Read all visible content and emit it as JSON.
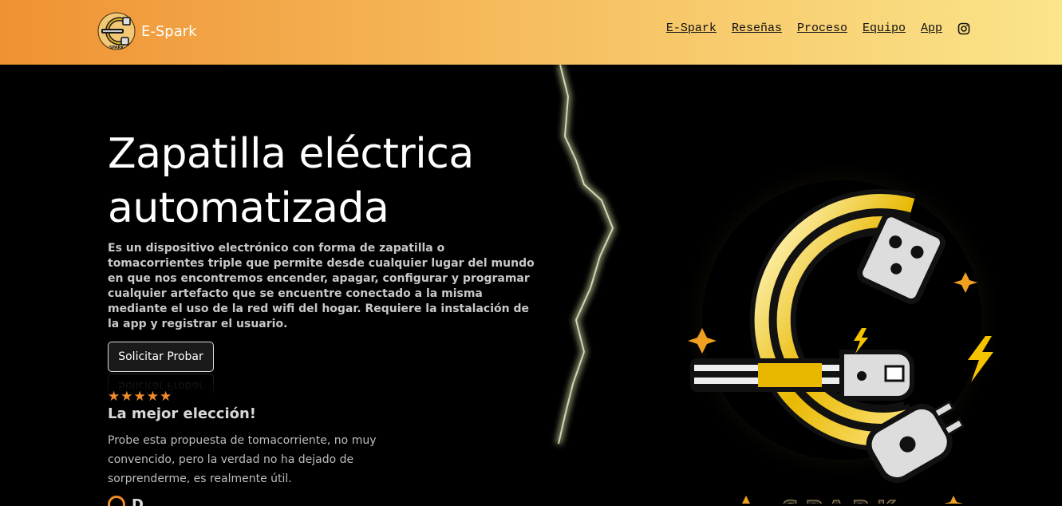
{
  "navbar": {
    "brand": "E-Spark",
    "links": [
      "E-Spark",
      "Reseñas",
      "Proceso",
      "Equipo",
      "App"
    ],
    "social_icon": "instagram-icon",
    "gradient": [
      "#ef9233",
      "#fbe58a"
    ]
  },
  "hero": {
    "title": "Zapatilla eléctrica automatizada",
    "description": "Es un dispositivo electrónico con forma de zapatilla o tomacorrientes triple que permite desde cualquier lugar del mundo en que nos encontremos encender, apagar, configurar y programar cualquier artefacto que se encuentre conectado a la misma mediante el uso de la red wifi del hogar. Requiere la instalación de la app y registrar el usuario.",
    "cta_label": "Solicitar Probar",
    "logo_text": "SPARK"
  },
  "review": {
    "rating": 5,
    "title": "La mejor elección!",
    "text": "Probe esta propuesta de tomacorriente, no muy convencido, pero la verdad no ha dejado de sorprenderme, es realmente útil.",
    "reviewer_name": "D"
  },
  "colors": {
    "accent": "#f08c2c",
    "background": "#000000"
  }
}
